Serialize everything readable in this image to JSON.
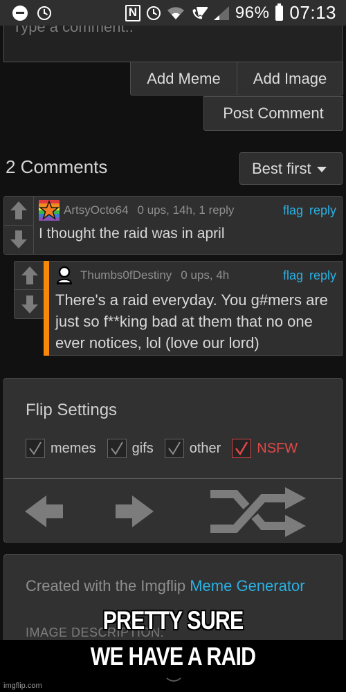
{
  "status_bar": {
    "battery": "96%",
    "time": "07:13",
    "icons": [
      "do-not-disturb-icon",
      "alarm-icon",
      "nfc-icon",
      "alarm-icon",
      "wifi-icon",
      "wifi-calling-icon",
      "signal-icon",
      "battery-icon"
    ]
  },
  "comment_form": {
    "placeholder": "Type a comment..",
    "add_meme_label": "Add Meme",
    "add_image_label": "Add Image",
    "post_label": "Post Comment"
  },
  "comments_header": {
    "count_label": "2 Comments",
    "sort_selected": "Best first"
  },
  "comments": [
    {
      "username": "ArtsyOcto64",
      "meta": "0 ups, 14h, 1 reply",
      "flag_label": "flag",
      "reply_label": "reply",
      "text": "I thought the raid was in april",
      "avatar": "rainbow-star"
    },
    {
      "username": "Thumbs0fDestiny",
      "meta": "0 ups, 4h",
      "flag_label": "flag",
      "reply_label": "reply",
      "text": "There's a raid everyday. You g#mers are just so f**king bad at them that no one ever notices, lol (love our lord)",
      "avatar": "default-user",
      "is_reply": true,
      "accent_color": "#f7890a"
    }
  ],
  "flip_settings": {
    "title": "Flip Settings",
    "options": [
      {
        "label": "memes",
        "checked": true
      },
      {
        "label": "gifs",
        "checked": true
      },
      {
        "label": "other",
        "checked": true
      },
      {
        "label": "NSFW",
        "checked": true,
        "color": "#e04848"
      }
    ]
  },
  "description": {
    "created_prefix": "Created with the Imgflip ",
    "link_label": "Meme Generator",
    "image_desc_label": "IMAGE DESCRIPTION:"
  },
  "meme_caption": {
    "line1": "PRETTY SURE",
    "line2": "WE HAVE A RAID"
  },
  "watermark": "imgflip.com",
  "colors": {
    "link": "#2bb0e3",
    "reply_accent": "#f7890a",
    "nsfw": "#e04848",
    "background": "#111111",
    "panel": "#313131"
  }
}
